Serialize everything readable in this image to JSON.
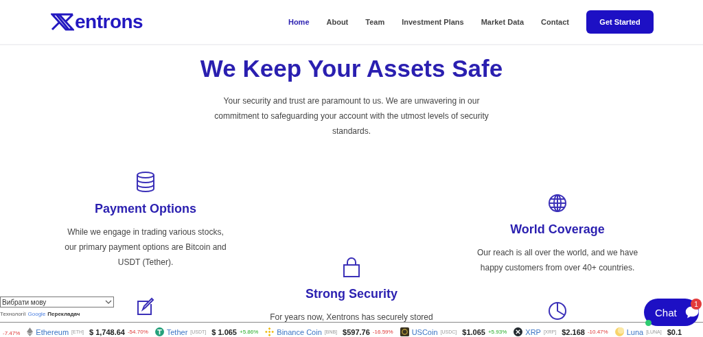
{
  "header": {
    "logo": "entrons",
    "nav": [
      {
        "label": "Home",
        "selected": true
      },
      {
        "label": "About",
        "selected": false
      },
      {
        "label": "Team",
        "selected": false
      },
      {
        "label": "Investment Plans",
        "selected": false
      },
      {
        "label": "Market Data",
        "selected": false
      },
      {
        "label": "Contact",
        "selected": false
      }
    ],
    "cta": "Get Started"
  },
  "hero": {
    "title": "We Keep Your Assets Safe",
    "text": "Your security and trust are paramount to us. We are unwavering in our commitment to safeguarding your account with the utmost levels of security standards."
  },
  "feature_columns": [
    [
      {
        "kind": "database",
        "title": "Payment Options",
        "text": "While we engage in trading various stocks, our primary payment options are Bitcoin and USDT (Tether)."
      },
      {
        "kind": "pen"
      }
    ],
    [
      {
        "kind": "lock",
        "title": "Strong Security",
        "text": "For years now, Xentrons has securely stored"
      }
    ],
    [
      {
        "kind": "globe",
        "title": "World Coverage",
        "text": "Our reach is all over the world, and we have happy customers from over 40+ countries."
      },
      {
        "kind": "pie"
      }
    ]
  ],
  "language": {
    "select": "Вибрати мову",
    "powered": "Технології",
    "google": "Google",
    "translator": "Перекладач"
  },
  "ticker": [
    {
      "change": "-7.47%",
      "rising": false
    },
    {
      "kind": "eth",
      "name": "Ethereum",
      "symbol": "[ETH]",
      "price": "$ 1,748.64",
      "change": "-54.70%",
      "rising": false
    },
    {
      "kind": "tether",
      "name": "Tether",
      "symbol": "[USDT]",
      "price": "$ 1.065",
      "change": "+5.86%",
      "rising": true
    },
    {
      "kind": "bnb",
      "name": "Binance Coin",
      "symbol": "[BNB]",
      "price": "$597.76",
      "change": "-16.59%",
      "rising": false
    },
    {
      "kind": "usdc",
      "name": "USCoin",
      "symbol": "[USDC]",
      "price": "$1.065",
      "change": "+5.93%",
      "rising": true
    },
    {
      "kind": "xrp",
      "name": "XRP",
      "symbol": "[XRP]",
      "price": "$2.168",
      "change": "-10.47%",
      "rising": false
    },
    {
      "kind": "luna",
      "name": "Luna",
      "symbol": "[LUNA]",
      "price": "$0.1"
    }
  ],
  "chat": {
    "label": "Chat",
    "badge": "1",
    "online": true
  }
}
